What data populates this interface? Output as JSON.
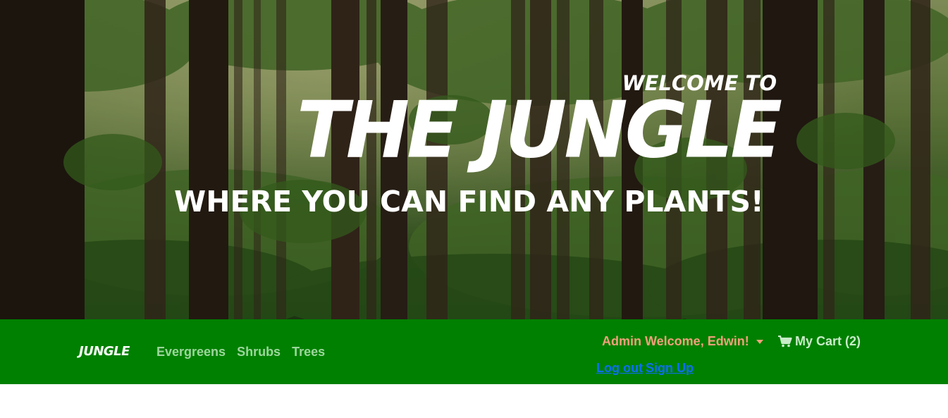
{
  "hero": {
    "welcome": "WELCOME TO",
    "title": "THE JUNGLE",
    "subtitle": "WHERE YOU CAN FIND ANY PLANTS!"
  },
  "navbar": {
    "brand": "JUNGLE",
    "links": [
      "Evergreens",
      "Shrubs",
      "Trees"
    ],
    "user_menu": "Admin Welcome, Edwin!",
    "cart_label": "My Cart (2)",
    "auth_links": [
      "Log out",
      "Sign Up"
    ]
  },
  "colors": {
    "navbar_bg": "#008000",
    "brand": "#ffffff",
    "nav_link": "#b8e6b8",
    "user_menu": "#f2a07b",
    "auth_link": "#0d6efd"
  },
  "icons": {
    "cart": "shopping-cart-icon",
    "dropdown": "caret-down-icon"
  }
}
